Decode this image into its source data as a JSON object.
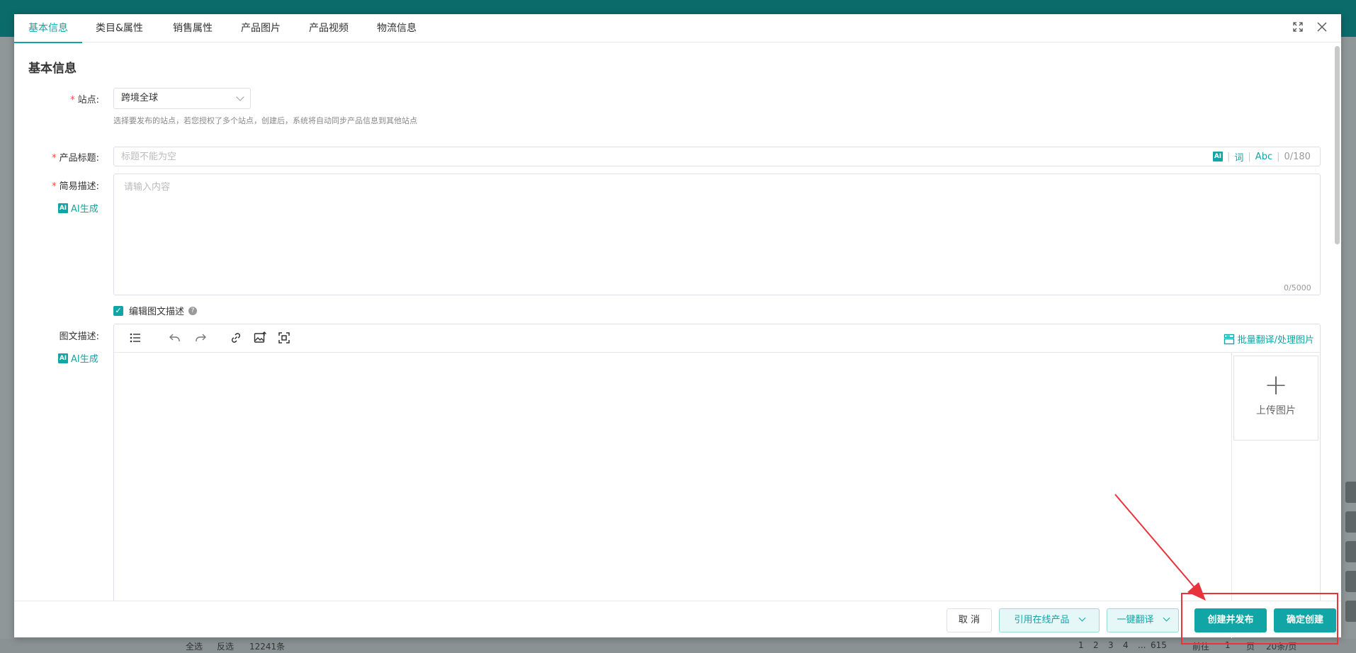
{
  "background": {
    "pagination_items": [
      "1",
      "2",
      "3",
      "4",
      "...",
      "615"
    ],
    "footer_left": [
      "全选",
      "反选",
      "12241条"
    ],
    "pagination_goto": "前往",
    "pagination_page": "1",
    "pagination_suffix": "页",
    "pagination_per_page": "20条/页"
  },
  "tabs": [
    {
      "label": "基本信息",
      "active": true
    },
    {
      "label": "类目&属性"
    },
    {
      "label": "销售属性"
    },
    {
      "label": "产品图片"
    },
    {
      "label": "产品视频"
    },
    {
      "label": "物流信息"
    }
  ],
  "window": {
    "expand_icon": "expand-icon",
    "close_icon": "close-icon"
  },
  "section_title": "基本信息",
  "site": {
    "label": "站点:",
    "value": "跨境全球",
    "hint": "选择要发布的站点，若您授权了多个站点，创建后，系统将自动同步产品信息到其他站点"
  },
  "product_title": {
    "label": "产品标题:",
    "placeholder": "标题不能为空",
    "ai": "AI",
    "word": "词",
    "abc": "Abc",
    "count": "0/180"
  },
  "short_desc": {
    "label": "简易描述:",
    "placeholder": "请输入内容",
    "count": "0/5000",
    "ai_badge": "AI",
    "ai_gen": "AI生成"
  },
  "rich_desc_toggle": {
    "label": "编辑图文描述",
    "help": "?"
  },
  "rich_desc": {
    "label": "图文描述:",
    "ai_badge": "AI",
    "ai_gen": "AI生成",
    "batch_link": "批量翻译/处理图片",
    "upload_plus": "+",
    "upload_label": "上传图片"
  },
  "footer": {
    "cancel": "取 消",
    "quote": "引用在线产品",
    "translate": "一键翻译",
    "create_publish": "创建并发布",
    "confirm_create": "确定创建"
  },
  "colors": {
    "accent": "#11a5a5",
    "required": "#f04848",
    "annotation": "#e8333c"
  }
}
